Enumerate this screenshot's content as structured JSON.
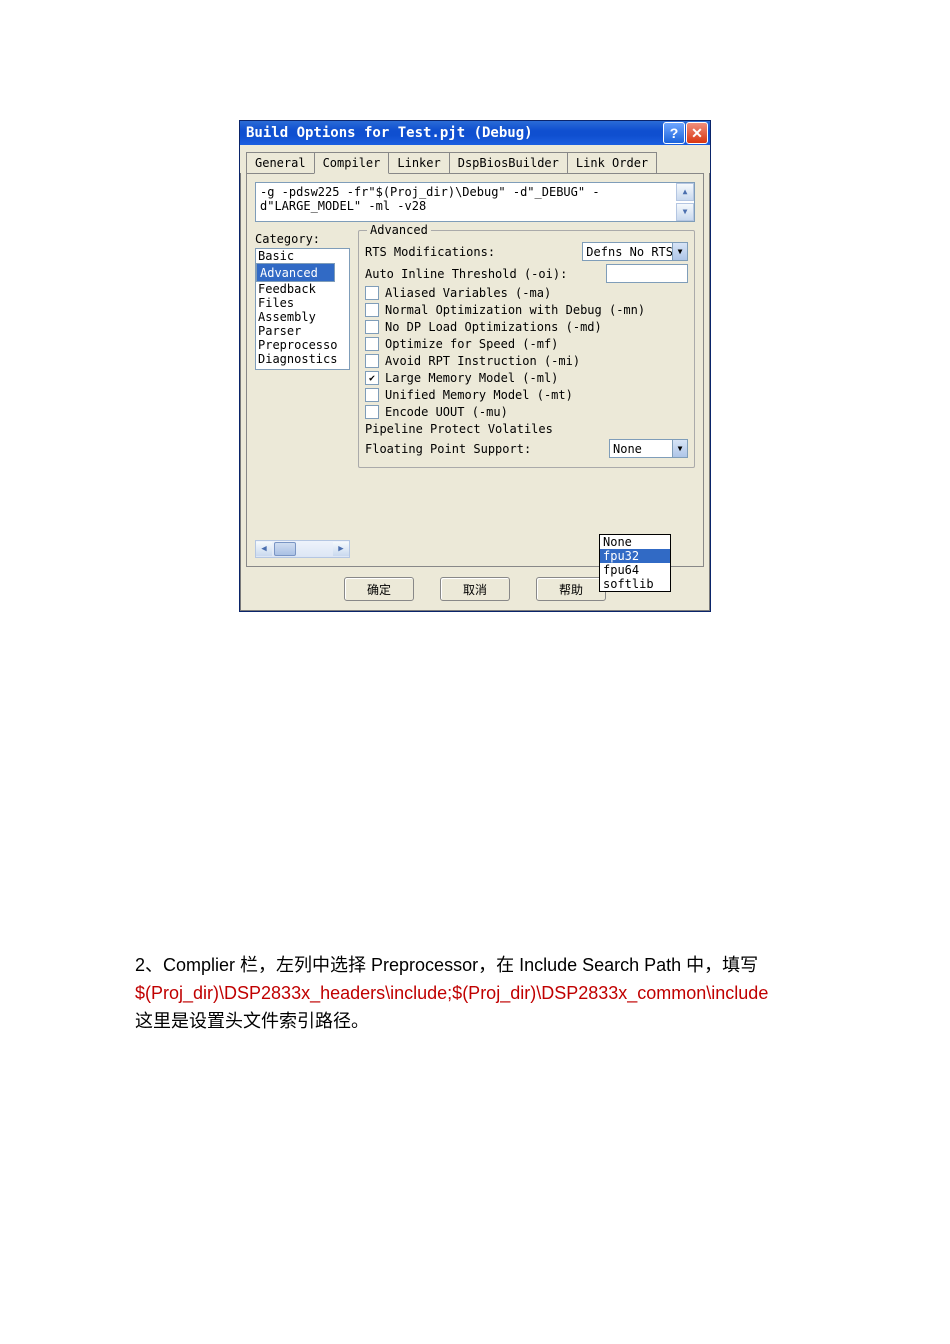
{
  "dialog": {
    "title": "Build Options for Test.pjt (Debug)",
    "help_glyph": "?",
    "close_glyph": "✕",
    "tabs": [
      "General",
      "Compiler",
      "Linker",
      "DspBiosBuilder",
      "Link Order"
    ],
    "active_tab": 1,
    "cmd": "-g -pdsw225 -fr\"$(Proj_dir)\\Debug\" -d\"_DEBUG\" -d\"LARGE_MODEL\" -ml -v28",
    "category_label": "Category:",
    "categories": [
      "Basic",
      "Advanced",
      "Feedback",
      "Files",
      "Assembly",
      "Parser",
      "Preprocesso",
      "Diagnostics"
    ],
    "selected_category": "Advanced",
    "group_title": "Advanced",
    "rts_label": "RTS Modifications:",
    "rts_value": "Defns No RTS",
    "oi_label": "Auto Inline Threshold (-oi):",
    "checks": {
      "ma": {
        "label": "Aliased Variables (-ma)",
        "checked": false
      },
      "mn": {
        "label": "Normal Optimization with Debug (-mn)",
        "checked": false
      },
      "md": {
        "label": "No DP Load Optimizations (-md)",
        "checked": false
      },
      "mf": {
        "label": "Optimize for Speed (-mf)",
        "checked": false
      },
      "mi": {
        "label": "Avoid RPT Instruction (-mi)",
        "checked": false
      },
      "ml": {
        "label": "Large Memory Model (-ml)",
        "checked": true
      },
      "mt": {
        "label": "Unified Memory Model (-mt)",
        "checked": false
      },
      "mu": {
        "label": "Encode UOUT (-mu)",
        "checked": false
      }
    },
    "ppv_label": "Pipeline Protect Volatiles",
    "fps_label": "Floating Point Support:",
    "fps_value": "None",
    "fps_options": [
      "None",
      "fpu32",
      "fpu64",
      "softlib"
    ],
    "fps_highlight": "fpu32",
    "buttons": {
      "ok": "确定",
      "cancel": "取消",
      "help": "帮助"
    }
  },
  "doc": {
    "p1_a": "2、Complier 栏，左列中选择 Preprocessor，在 Include Search Path 中，填写",
    "p_red": "$(Proj_dir)\\DSP2833x_headers\\include;$(Proj_dir)\\DSP2833x_common\\include",
    "p2": "这里是设置头文件索引路径。"
  }
}
